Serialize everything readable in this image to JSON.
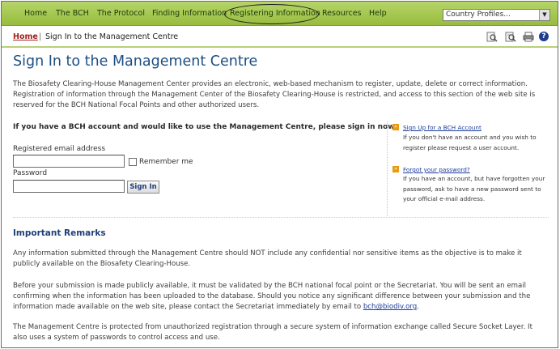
{
  "nav": {
    "items": [
      {
        "label": "Home"
      },
      {
        "label": "The BCH"
      },
      {
        "label": "The Protocol"
      },
      {
        "label": "Finding Information"
      },
      {
        "label": "Registering Information"
      },
      {
        "label": "Resources"
      },
      {
        "label": "Help"
      }
    ],
    "country_select": {
      "value": "Country Profiles..."
    }
  },
  "breadcrumb": {
    "home": "Home",
    "separator": "|",
    "current": "Sign In to the Management Centre"
  },
  "toolbar": {
    "icons": [
      "search-icon",
      "search-document-icon",
      "print-icon",
      "help-icon"
    ],
    "help_glyph": "?"
  },
  "page": {
    "title": "Sign In to the Management Centre",
    "intro": "The Biosafety Clearing-House Management Center provides an electronic, web-based mechanism to register, update, delete or correct information. Registration of information through the Management Center of the Biosafety Clearing-House is restricted, and access to this section of the web site is reserved for the BCH National Focal Points and other authorized users."
  },
  "signin": {
    "heading": "If you have a BCH account and would like to use the Management Centre, please sign in now:",
    "email_label": "Registered email address",
    "email_value": "",
    "remember_label": "Remember me",
    "password_label": "Password",
    "password_value": "",
    "button": "Sign In"
  },
  "side": {
    "signup_link": "Sign Up for a BCH Account",
    "signup_text": "If you don't have an account and you wish to register please request a user account.",
    "forgot_link": "Forgot your password?",
    "forgot_text": "If you have an account, but have forgotten your password, ask to have a new password sent to your official e-mail address."
  },
  "remarks": {
    "heading": "Important Remarks",
    "p1": "Any information submitted through the Management Centre should NOT include any confidential nor sensitive items as the objective is to make it publicly available on the Biosafety Clearing-House.",
    "p2_text": "Before your submission is made publicly available, it must be validated by the BCH national focal point or the Secretariat. You will be sent an email confirming when the information has been uploaded to the database. Should you notice any significant difference between your submission and the information made available on the web site, please contact the Secretariat immediately by email to ",
    "p2_email": "bch@biodiv.org",
    "p2_end": ".",
    "p3": "The Management Centre is protected from unauthorized registration through a secure system of information exchange called Secure Socket Layer. It also uses a system of passwords to control access and use."
  },
  "colors": {
    "nav_green": "#a6c954",
    "title_blue": "#1d4e82",
    "home_red": "#a11f1f",
    "bullet_orange": "#e79a14"
  }
}
